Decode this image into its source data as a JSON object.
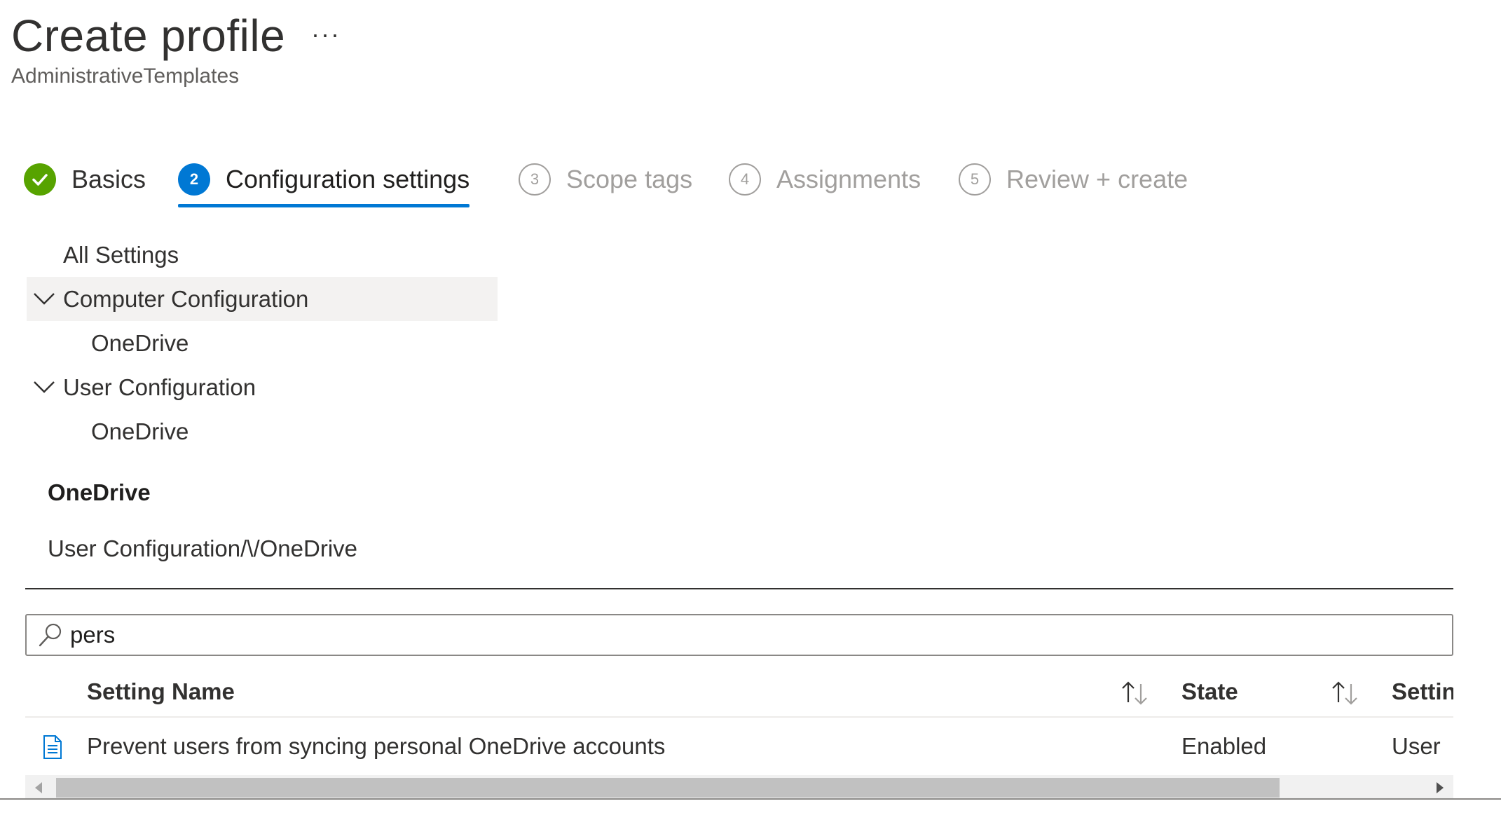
{
  "header": {
    "title": "Create profile",
    "more": "···",
    "subtitle": "AdministrativeTemplates"
  },
  "steps": [
    {
      "label": "Basics",
      "status": "done",
      "marker": "✓"
    },
    {
      "label": "Configuration settings",
      "status": "active",
      "marker": "2"
    },
    {
      "label": "Scope tags",
      "status": "pending",
      "marker": "3"
    },
    {
      "label": "Assignments",
      "status": "pending",
      "marker": "4"
    },
    {
      "label": "Review + create",
      "status": "pending",
      "marker": "5"
    }
  ],
  "tree": {
    "all_settings": "All Settings",
    "computer_configuration": "Computer Configuration",
    "computer_onedrive": "OneDrive",
    "user_configuration": "User Configuration",
    "user_onedrive": "OneDrive"
  },
  "section": {
    "title": "OneDrive",
    "path": "User Configuration/\\/OneDrive"
  },
  "search": {
    "value": "pers",
    "icon": "search-icon"
  },
  "table": {
    "columns": [
      "Setting Name",
      "State",
      "Settin"
    ],
    "rows": [
      {
        "name": "Prevent users from syncing personal OneDrive accounts",
        "state": "Enabled",
        "setting_type": "User"
      }
    ]
  },
  "colors": {
    "accent": "#0078d4",
    "success": "#57a300",
    "muted": "#a19f9d"
  }
}
